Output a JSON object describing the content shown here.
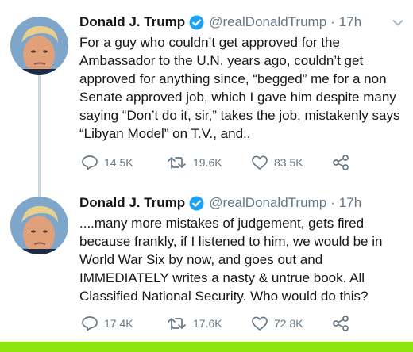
{
  "tweets": [
    {
      "author": "Donald J. Trump",
      "handle": "@realDonaldTrump",
      "separator": "·",
      "time": "17h",
      "lines": [
        "For a guy who couldn’t get approved for the",
        "Ambassador to the U.N. years ago, couldn’t get",
        "approved for anything since, “begged” me for a non",
        "Senate approved job, which I gave him despite many",
        "saying “Don’t do it, sir,” takes the job, mistakenly says",
        "“Libyan Model” on T.V., and.."
      ],
      "replies": "14.5K",
      "retweets": "19.6K",
      "likes": "83.5K"
    },
    {
      "author": "Donald J. Trump",
      "handle": "@realDonaldTrump",
      "separator": "·",
      "time": "17h",
      "lines": [
        "....many more mistakes of judgement, gets fired",
        "because frankly, if I listened to him, we would be in",
        "World War Six by now, and goes out and",
        "IMMEDIATELY writes a nasty & untrue book. All",
        "Classified National Security. Who would do this?"
      ],
      "replies": "17.4K",
      "retweets": "17.6K",
      "likes": "72.8K"
    }
  ],
  "icons": {
    "verified": "verified-badge-icon",
    "caret": "chevron-down-icon",
    "reply": "reply-icon",
    "retweet": "retweet-icon",
    "like": "heart-icon",
    "share": "share-icon"
  },
  "colors": {
    "verified_blue": "#1da1f2",
    "muted_text": "#657786",
    "thread_line": "#ccd6dd",
    "bottom_bar": "#8de40c"
  }
}
